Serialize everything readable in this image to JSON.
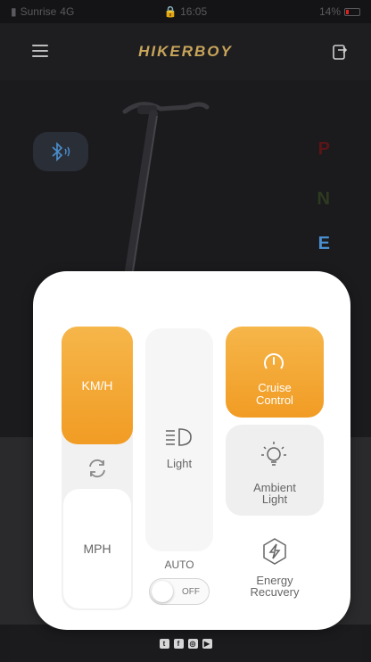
{
  "status_bar": {
    "carrier": "Sunrise",
    "network": "4G",
    "time": "16:05",
    "battery": "14%"
  },
  "header": {
    "brand": "HIKERBOY",
    "icons": [
      "menu-icon",
      "export-icon"
    ]
  },
  "dashboard": {
    "bluetooth_icon": "bluetooth-icon",
    "gears": [
      "P",
      "N",
      "E"
    ],
    "active_gear": "E"
  },
  "control_panel": {
    "unit_kmh": "KM/H",
    "unit_mph": "MPH",
    "active_unit": "KM/H",
    "light_label": "Light",
    "auto_label": "AUTO",
    "auto_toggle": "OFF",
    "cruise_label_1": "Cruise",
    "cruise_label_2": "Control",
    "ambient_label_1": "Ambient",
    "ambient_label_2": "Light",
    "energy_label_1": "Energy",
    "energy_label_2": "Recuvery"
  },
  "footer": {
    "social_icons": [
      "twitter-icon",
      "facebook-icon",
      "instagram-icon",
      "youtube-icon"
    ]
  },
  "colors": {
    "accent": "#f19c24",
    "background": "#1b1b1e",
    "brand": "#c9a55a",
    "gear_e": "#4a8fcf"
  }
}
